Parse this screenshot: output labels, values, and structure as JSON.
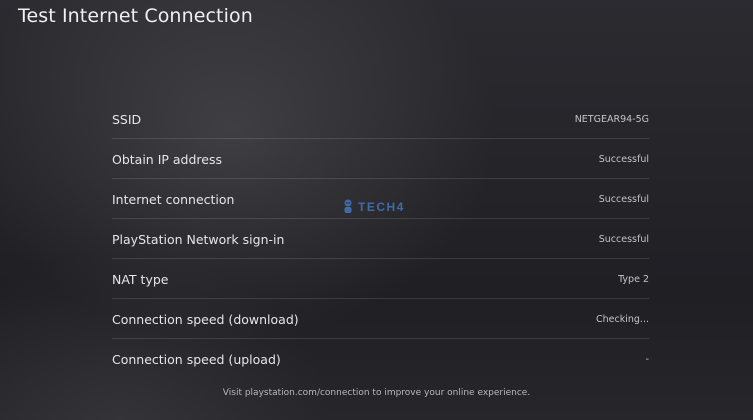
{
  "header": {
    "title": "Test Internet Connection"
  },
  "results": [
    {
      "label": "SSID",
      "value": "NETGEAR94-5G"
    },
    {
      "label": "Obtain IP address",
      "value": "Successful"
    },
    {
      "label": "Internet connection",
      "value": "Successful"
    },
    {
      "label": "PlayStation Network sign-in",
      "value": "Successful"
    },
    {
      "label": "NAT type",
      "value": "Type 2"
    },
    {
      "label": "Connection speed (download)",
      "value": "Checking..."
    },
    {
      "label": "Connection speed (upload)",
      "value": "-"
    }
  ],
  "watermark": {
    "text": "TECH4",
    "icon": "tech4-mascot-icon",
    "color": "#4a7fd0"
  },
  "footer": {
    "note": "Visit playstation.com/connection to improve your online experience."
  }
}
